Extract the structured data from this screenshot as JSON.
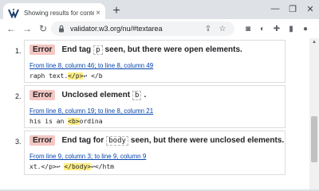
{
  "tab": {
    "title": "Showing results for contents of te",
    "close": "×"
  },
  "newtab": "+",
  "window_controls": {
    "minimize": "—",
    "restore": "❐",
    "close": "✕"
  },
  "nav": {
    "back": "←",
    "forward": "→",
    "reload": "↻"
  },
  "omnibox": {
    "url": "validator.w3.org/nu/#textarea"
  },
  "toolbar_icons": {
    "share": "⇪",
    "star": "☆",
    "camera": "◙",
    "dark_mode": "◐",
    "extensions": "✚",
    "sidepanel": "▮",
    "profile": "●",
    "menu": "⋮"
  },
  "messages": [
    {
      "number": "1.",
      "badge": "Error",
      "text_before": "End tag",
      "code": "p",
      "text_after": "seen, but there were open elements.",
      "location": "From line 8, column 46; to line 8, column 49",
      "extract_before": "raph text.",
      "extract_highlight": "</p>",
      "extract_after": "↩  </b"
    },
    {
      "number": "2.",
      "badge": "Error",
      "text_before": "Unclosed element",
      "code": "b",
      "text_after": ".",
      "location": "From line 8, column 19; to line 8, column 21",
      "extract_before": "his is an ",
      "extract_highlight": "<b>",
      "extract_after": "ordina"
    },
    {
      "number": "3.",
      "badge": "Error",
      "text_before": "End tag for",
      "code": "body",
      "text_after": "seen, but there were unclosed elements.",
      "location": "From line 9, column 3; to line 9, column 9",
      "extract_before": "xt.</p>↩  ",
      "extract_highlight": "</body>",
      "extract_after": "↩</htm"
    }
  ],
  "colors": {
    "badge_bg": "#f4c7c3",
    "highlight": "#ffef88",
    "link": "#0645ad"
  }
}
